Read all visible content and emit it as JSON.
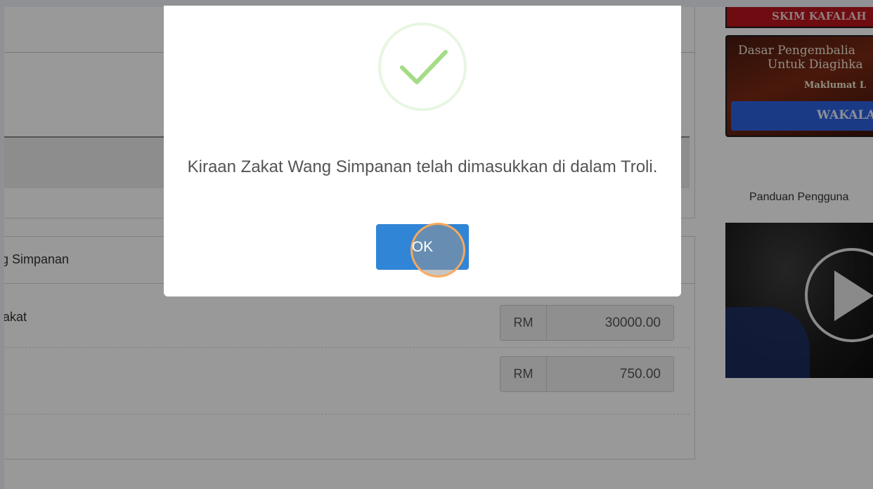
{
  "banners": {
    "top_label": "SKIM KAFALAH",
    "policy_line1": "Dasar Pengembalia",
    "policy_line2": "Untuk Diagihka",
    "policy_line3": "Maklumat L",
    "policy_button": "WAKALA"
  },
  "sidebar": {
    "guide_label": "Panduan Pengguna"
  },
  "calculator": {
    "title": "g Simpanan",
    "rows": [
      {
        "label": "akat",
        "currency": "RM",
        "value": "30000.00"
      },
      {
        "label": "",
        "currency": "RM",
        "value": "750.00"
      }
    ]
  },
  "modal": {
    "message": "Kiraan Zakat Wang Simpanan telah dimasukkan di dalam Troli.",
    "ok_label": "OK",
    "icon": "success-check-icon"
  },
  "colors": {
    "ok_button": "#3085d6",
    "success_check": "#a5dc86",
    "policy_button": "#2e62e0",
    "top_banner": "#b8141d"
  }
}
